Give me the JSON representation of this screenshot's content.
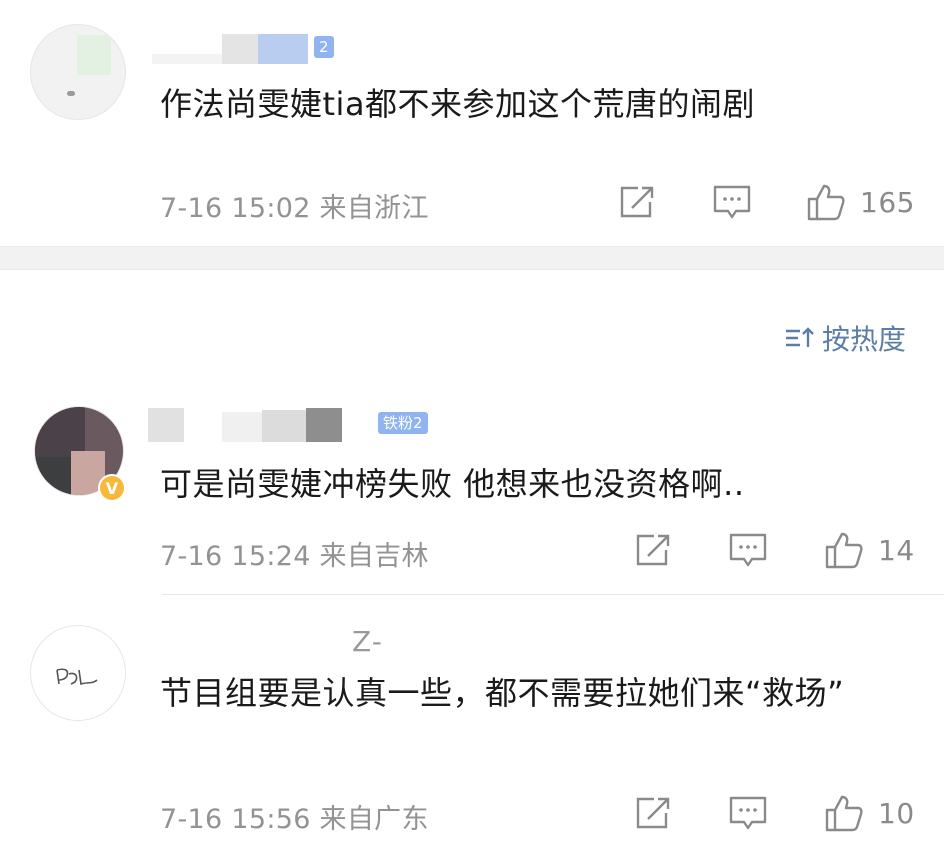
{
  "comments": [
    {
      "text": "作法尚雯婕tia都不来参加这个荒唐的闹剧",
      "meta": "7-16 15:02 来自浙江",
      "badge": "2",
      "likes": "165"
    },
    {
      "text": "可是尚雯婕冲榜失败 他想来也没资格啊..",
      "meta": "7-16 15:24 来自吉林",
      "badge": "铁粉2",
      "vip": "V",
      "likes": "14"
    },
    {
      "text": "节目组要是认真一些，都不需要拉她们来“救场”",
      "meta": "7-16 15:56 来自广东",
      "name_fragment": "Z-",
      "likes": "10"
    }
  ],
  "sort": {
    "label": "按热度"
  },
  "icons": {
    "repost": "repost-icon",
    "comment": "comment-icon",
    "like": "thumbs-up-icon",
    "sort": "sort-icon"
  },
  "colors": {
    "accent": "#5b7ea8",
    "meta_gray": "#939393",
    "badge_blue": "#8fb4ef",
    "vip_gold": "#f6b93b"
  }
}
